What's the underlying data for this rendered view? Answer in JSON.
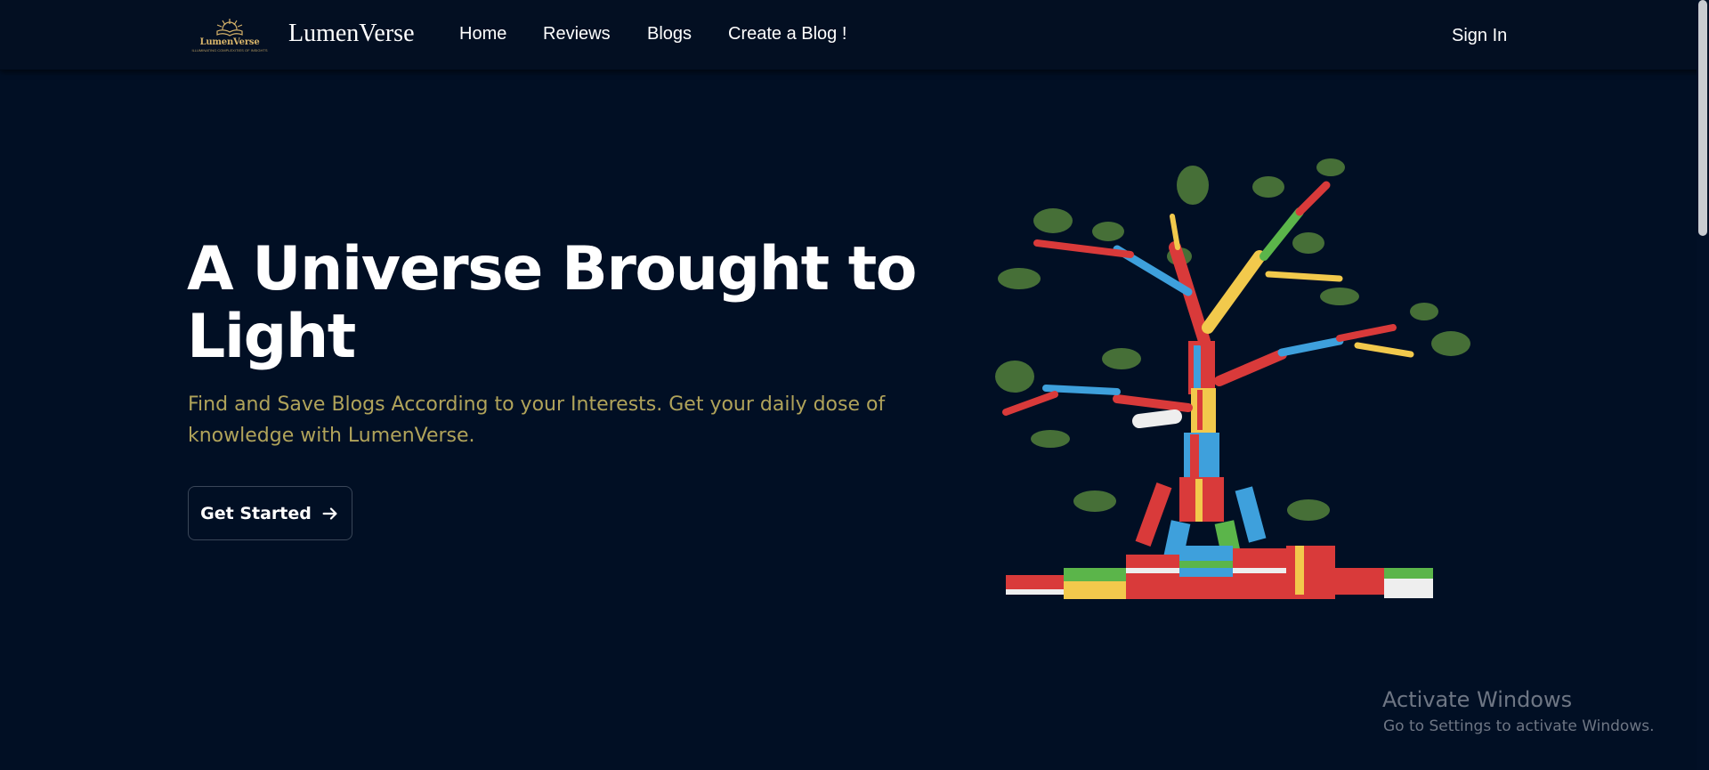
{
  "navbar": {
    "logo": {
      "icon": "sunrise-book-logo",
      "text": "LumenVerse",
      "tagline": "ILLUMINATING COMPLEXITIES OF INSIGHTS"
    },
    "brand": "LumenVerse",
    "links": [
      {
        "label": "Home"
      },
      {
        "label": "Reviews"
      },
      {
        "label": "Blogs"
      },
      {
        "label": "Create a Blog !"
      }
    ],
    "sign_in": "Sign In"
  },
  "hero": {
    "title": "A Universe Brought to Light",
    "subtitle": "Find and Save Blogs According to your Interests. Get your daily dose of knowledge with LumenVerse.",
    "cta_label": "Get Started",
    "cta_icon": "arrow-right-icon",
    "illustration": "book-tree-illustration"
  },
  "watermark": {
    "title": "Activate Windows",
    "subtitle": "Go to Settings to activate Windows."
  },
  "colors": {
    "background": "#010f24",
    "navbar": "#030f22",
    "subtitle": "#b0a35a",
    "logo_gold": "#d9b56b"
  }
}
